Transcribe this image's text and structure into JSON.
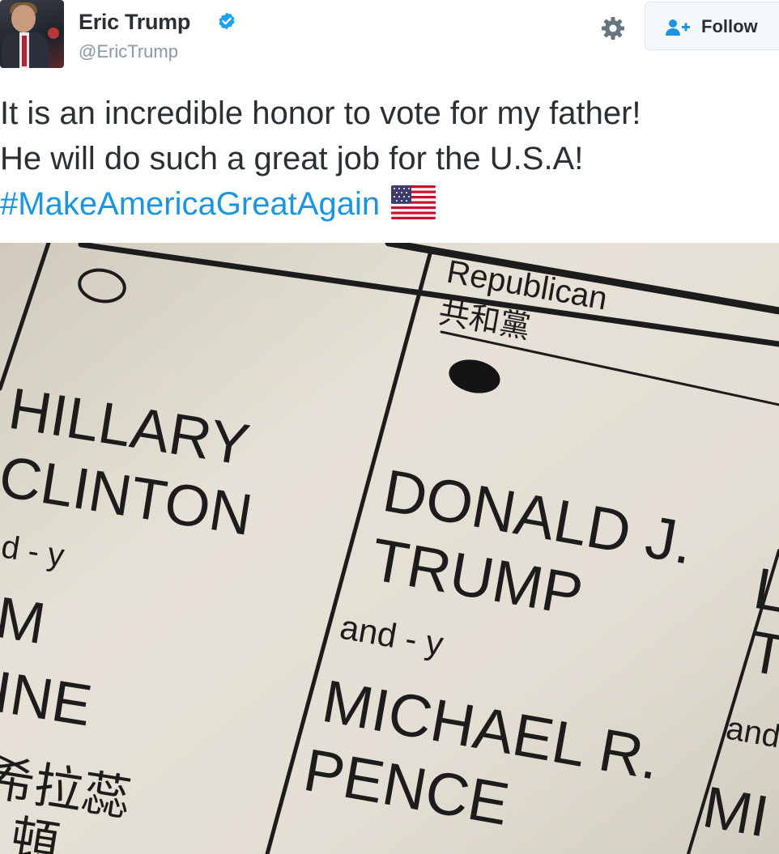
{
  "user": {
    "name": "Eric Trump",
    "handle": "@EricTrump",
    "verified": true
  },
  "actions": {
    "settings_icon": "gear-icon",
    "follow_icon": "add-user-icon",
    "follow_label": "Follow"
  },
  "tweet": {
    "line1": "It is an incredible honor to vote for my father!",
    "line2": "He will do such a great job for the U.S.A!",
    "hashtag": "#MakeAmericaGreatAgain",
    "emoji": "us-flag-icon"
  },
  "ballot": {
    "party": "Republican",
    "party_chinese": "共和黨",
    "candidate_left_first": "HILLARY",
    "candidate_left_last": "CLINTON",
    "left_and": "d - y",
    "left_running_mate_1": "M",
    "left_running_mate_2": "INE",
    "left_chinese": "希拉蕊",
    "left_chinese_2": "頓",
    "candidate_first": "DONALD J.",
    "candidate_last": "TRUMP",
    "and_label": "and - y",
    "running_mate_first": "MICHAEL R.",
    "running_mate_last": "PENCE",
    "right_partial_1": "L",
    "right_partial_2": "T",
    "right_and": "and",
    "right_partial_3": "MI"
  },
  "colors": {
    "text": "#292f33",
    "secondary": "#8899a6",
    "link": "#1b95e0",
    "verified": "#1da1f2",
    "paper": "#e2ddd2",
    "ink": "#1c1c1c"
  }
}
